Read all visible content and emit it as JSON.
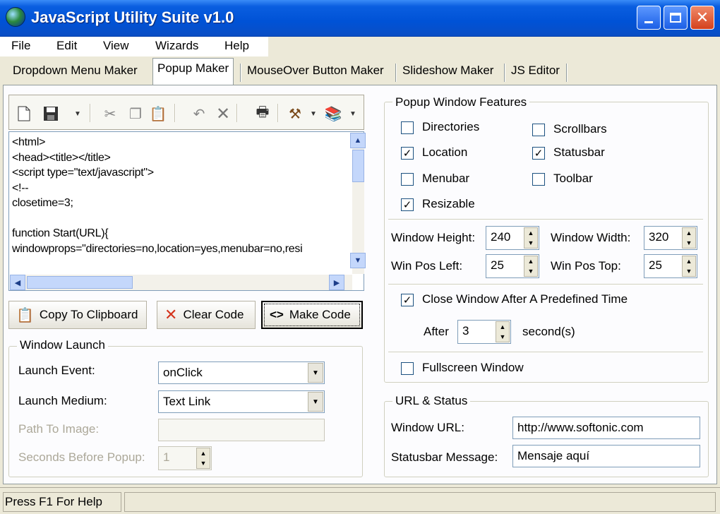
{
  "window": {
    "title": "JavaScript Utility Suite v1.0"
  },
  "menu": [
    "File",
    "Edit",
    "View",
    "Wizards",
    "Help"
  ],
  "tabs": [
    "Dropdown Menu Maker",
    "Popup Maker",
    "MouseOver Button Maker",
    "Slideshow Maker",
    "JS Editor"
  ],
  "active_tab": "Popup Maker",
  "toolbar": [
    "new-icon",
    "save-icon",
    "cut-icon",
    "copy-icon",
    "paste-icon",
    "undo-icon",
    "delete-icon",
    "print-icon",
    "tools-icon",
    "help-book-icon"
  ],
  "code": {
    "lines": [
      "<html>",
      "<head><title></title>",
      "<script type=\"text/javascript\">",
      "<!--",
      "closetime=3;",
      "",
      "function Start(URL){",
      "windowprops=\"directories=no,location=yes,menubar=no,resi"
    ]
  },
  "actions": {
    "copy": "Copy To Clipboard",
    "clear": "Clear Code",
    "make": "Make Code"
  },
  "launch": {
    "group_label": "Window Launch",
    "event_label": "Launch Event:",
    "event_value": "onClick",
    "medium_label": "Launch Medium:",
    "medium_value": "Text Link",
    "path_label": "Path To Image:",
    "path_value": "",
    "seconds_label": "Seconds Before Popup:",
    "seconds_value": "1"
  },
  "features": {
    "group_label": "Popup Window Features",
    "checkboxes": [
      {
        "label": "Directories",
        "checked": false
      },
      {
        "label": "Location",
        "checked": true
      },
      {
        "label": "Menubar",
        "checked": false
      },
      {
        "label": "Resizable",
        "checked": true
      },
      {
        "label": "Scrollbars",
        "checked": false
      },
      {
        "label": "Statusbar",
        "checked": true
      },
      {
        "label": "Toolbar",
        "checked": false
      }
    ],
    "height_label": "Window Height:",
    "height_value": "240",
    "width_label": "Window Width:",
    "width_value": "320",
    "left_label": "Win Pos Left:",
    "left_value": "25",
    "top_label": "Win Pos Top:",
    "top_value": "25",
    "close_label": "Close Window After A Predefined Time",
    "close_checked": true,
    "after_label": "After",
    "after_value": "3",
    "seconds_unit": "second(s)",
    "fullscreen_label": "Fullscreen Window",
    "fullscreen_checked": false
  },
  "url_status": {
    "group_label": "URL & Status",
    "url_label": "Window URL:",
    "url_value": "http://www.softonic.com",
    "status_label": "Statusbar Message:",
    "status_value": "Mensaje aquí"
  },
  "statusbar": {
    "help_text": "Press F1 For Help"
  },
  "colors": {
    "titlebar": "#0052d6",
    "face": "#ece9d8",
    "clear_x": "#d4341c"
  }
}
